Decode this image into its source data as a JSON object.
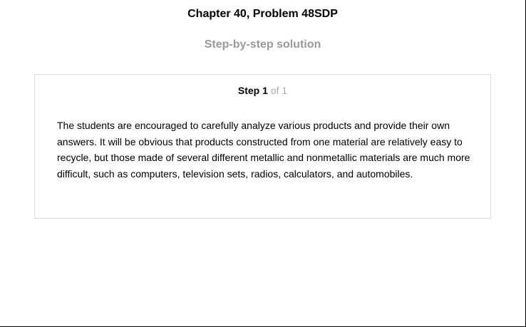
{
  "header": {
    "title": "Chapter 40, Problem 48SDP",
    "subtitle": "Step-by-step solution"
  },
  "step": {
    "label": "Step",
    "number": "1",
    "of_text": "of 1",
    "body": "The students are encouraged to carefully analyze various products and provide their own answers. It will be obvious that products constructed from one material are relatively easy to recycle, but those made of several different metallic and nonmetallic materials are much more difficult, such as computers, television sets, radios, calculators, and automobiles."
  }
}
